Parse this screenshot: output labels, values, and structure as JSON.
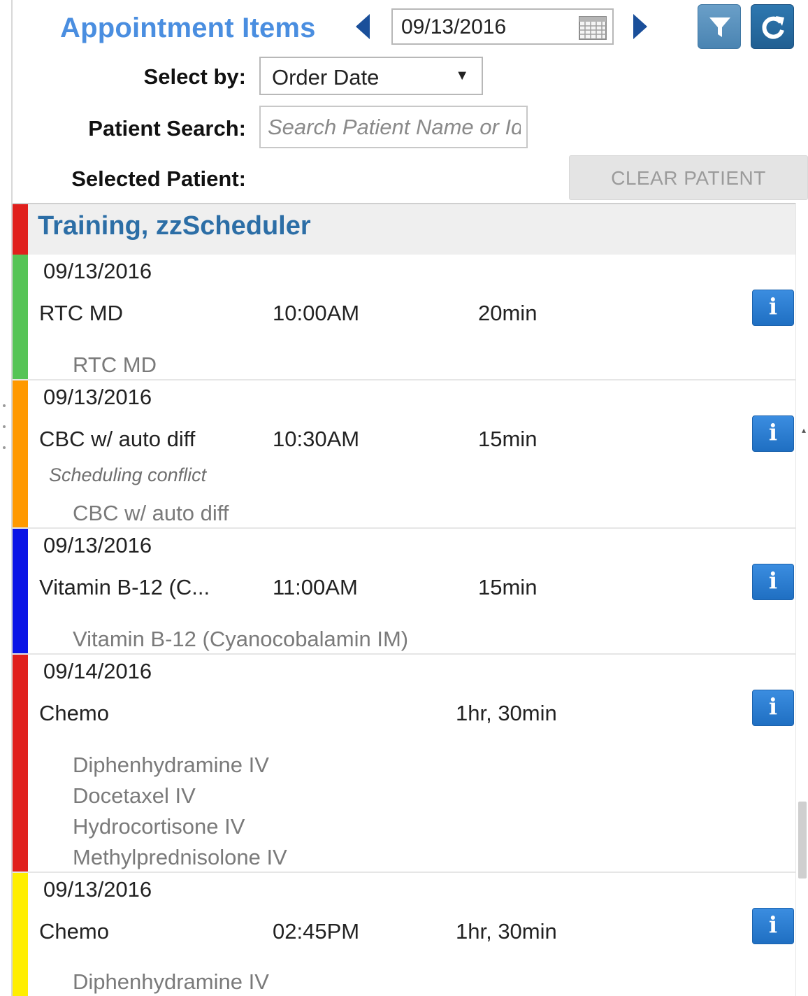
{
  "header": {
    "title": "Appointment Items",
    "date_value": "09/13/2016",
    "prev_icon": "triangle-left-icon",
    "next_icon": "triangle-right-icon",
    "calendar_icon": "calendar-icon",
    "filter_icon": "filter-icon",
    "refresh_icon": "refresh-icon"
  },
  "controls": {
    "select_by_label": "Select by:",
    "select_by_value": "Order Date",
    "patient_search_label": "Patient Search:",
    "patient_search_placeholder": "Search Patient Name or Id",
    "selected_patient_label": "Selected Patient:",
    "clear_patient_label": "CLEAR PATIENT"
  },
  "patient": {
    "name": "Training, zzScheduler",
    "color": "#e0201d"
  },
  "appointments": [
    {
      "date": "09/13/2016",
      "name": "RTC MD",
      "time": "10:00AM",
      "duration": "20min",
      "color": "#56c456",
      "conflict": "",
      "items": [
        "RTC MD"
      ]
    },
    {
      "date": "09/13/2016",
      "name": "CBC w/ auto diff",
      "time": "10:30AM",
      "duration": "15min",
      "color": "#ff9900",
      "conflict": "Scheduling conflict",
      "items": [
        "CBC w/ auto diff"
      ]
    },
    {
      "date": "09/13/2016",
      "name": "Vitamin B-12 (C...",
      "time": "11:00AM",
      "duration": "15min",
      "color": "#0a14e6",
      "conflict": "",
      "items": [
        "Vitamin B-12 (Cyanocobalamin IM)"
      ]
    },
    {
      "date": "09/14/2016",
      "name": "Chemo",
      "time": "",
      "duration": "1hr, 30min",
      "color": "#e0201d",
      "conflict": "",
      "items": [
        "Diphenhydramine IV",
        "Docetaxel IV",
        "Hydrocortisone IV",
        "Methylprednisolone IV"
      ]
    },
    {
      "date": "09/13/2016",
      "name": "Chemo",
      "time": "02:45PM",
      "duration": "1hr, 30min",
      "color": "#ffee00",
      "conflict": "",
      "items": [
        "Diphenhydramine IV"
      ]
    }
  ],
  "info_label": "i",
  "info_icon": "info-icon"
}
